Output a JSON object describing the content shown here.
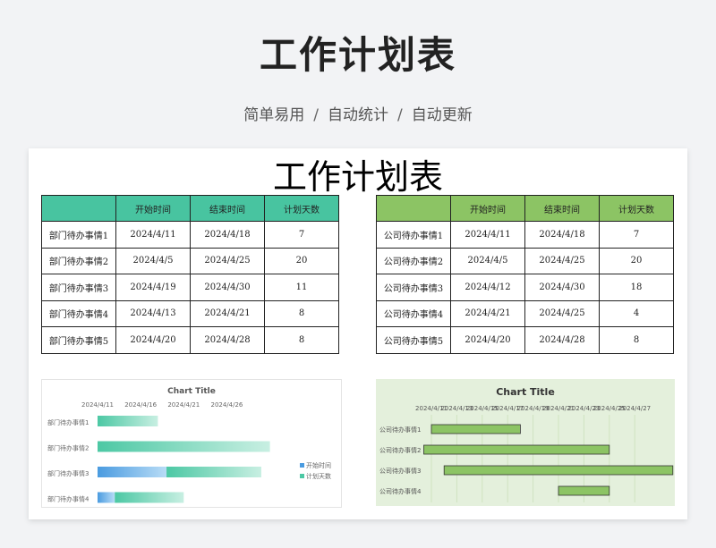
{
  "header": {
    "title": "工作计划表",
    "subtitle_parts": [
      "简单易用",
      "自动统计",
      "自动更新"
    ],
    "separator": "/"
  },
  "sheet": {
    "title": "工作计划表",
    "left_table": {
      "columns": [
        "",
        "开始时间",
        "结束时间",
        "计划天数"
      ],
      "rows": [
        [
          "部门待办事情1",
          "2024/4/11",
          "2024/4/18",
          "7"
        ],
        [
          "部门待办事情2",
          "2024/4/5",
          "2024/4/25",
          "20"
        ],
        [
          "部门待办事情3",
          "2024/4/19",
          "2024/4/30",
          "11"
        ],
        [
          "部门待办事情4",
          "2024/4/13",
          "2024/4/21",
          "8"
        ],
        [
          "部门待办事情5",
          "2024/4/20",
          "2024/4/28",
          "8"
        ]
      ]
    },
    "right_table": {
      "columns": [
        "",
        "开始时间",
        "结束时间",
        "计划天数"
      ],
      "rows": [
        [
          "公司待办事情1",
          "2024/4/11",
          "2024/4/18",
          "7"
        ],
        [
          "公司待办事情2",
          "2024/4/5",
          "2024/4/25",
          "20"
        ],
        [
          "公司待办事情3",
          "2024/4/12",
          "2024/4/30",
          "18"
        ],
        [
          "公司待办事情4",
          "2024/4/21",
          "2024/4/25",
          "4"
        ],
        [
          "公司待办事情5",
          "2024/4/20",
          "2024/4/28",
          "8"
        ]
      ]
    }
  },
  "colors": {
    "left_header": "#48c4a0",
    "right_header": "#8cc464",
    "left_bar_start": "#4a9be0",
    "left_bar_days": "#4cc8a4",
    "right_bar": "#8cc464"
  },
  "chart_data": [
    {
      "type": "bar",
      "orientation": "horizontal-stacked-gantt",
      "title": "Chart Title",
      "x_tick_labels": [
        "2024/4/11",
        "2024/4/16",
        "2024/4/21",
        "2024/4/26"
      ],
      "categories": [
        "部门待办事情1",
        "部门待办事情2",
        "部门待办事情3",
        "部门待办事情4"
      ],
      "series": [
        {
          "name": "开始时间",
          "start_dates": [
            "2024/4/11",
            "2024/4/11",
            "2024/4/11",
            "2024/4/11"
          ],
          "offset_days": [
            0,
            0,
            8,
            2
          ]
        },
        {
          "name": "计划天数",
          "values": [
            7,
            20,
            11,
            8
          ]
        }
      ],
      "xlim": [
        "2024/4/11",
        "2024/4/30"
      ],
      "legend": "right"
    },
    {
      "type": "bar",
      "orientation": "horizontal-gantt",
      "title": "Chart Title",
      "x_tick_labels": [
        "2024/4/11",
        "2024/4/13",
        "2024/4/15",
        "2024/4/17",
        "2024/4/19",
        "2024/4/21",
        "2024/4/23",
        "2024/4/25",
        "2024/4/27"
      ],
      "categories": [
        "公司待办事情1",
        "公司待办事情2",
        "公司待办事情3",
        "公司待办事情4"
      ],
      "start": [
        "2024/4/11",
        "2024/4/5",
        "2024/4/12",
        "2024/4/21"
      ],
      "end": [
        "2024/4/18",
        "2024/4/25",
        "2024/4/30",
        "2024/4/25"
      ],
      "legend": "none"
    }
  ]
}
